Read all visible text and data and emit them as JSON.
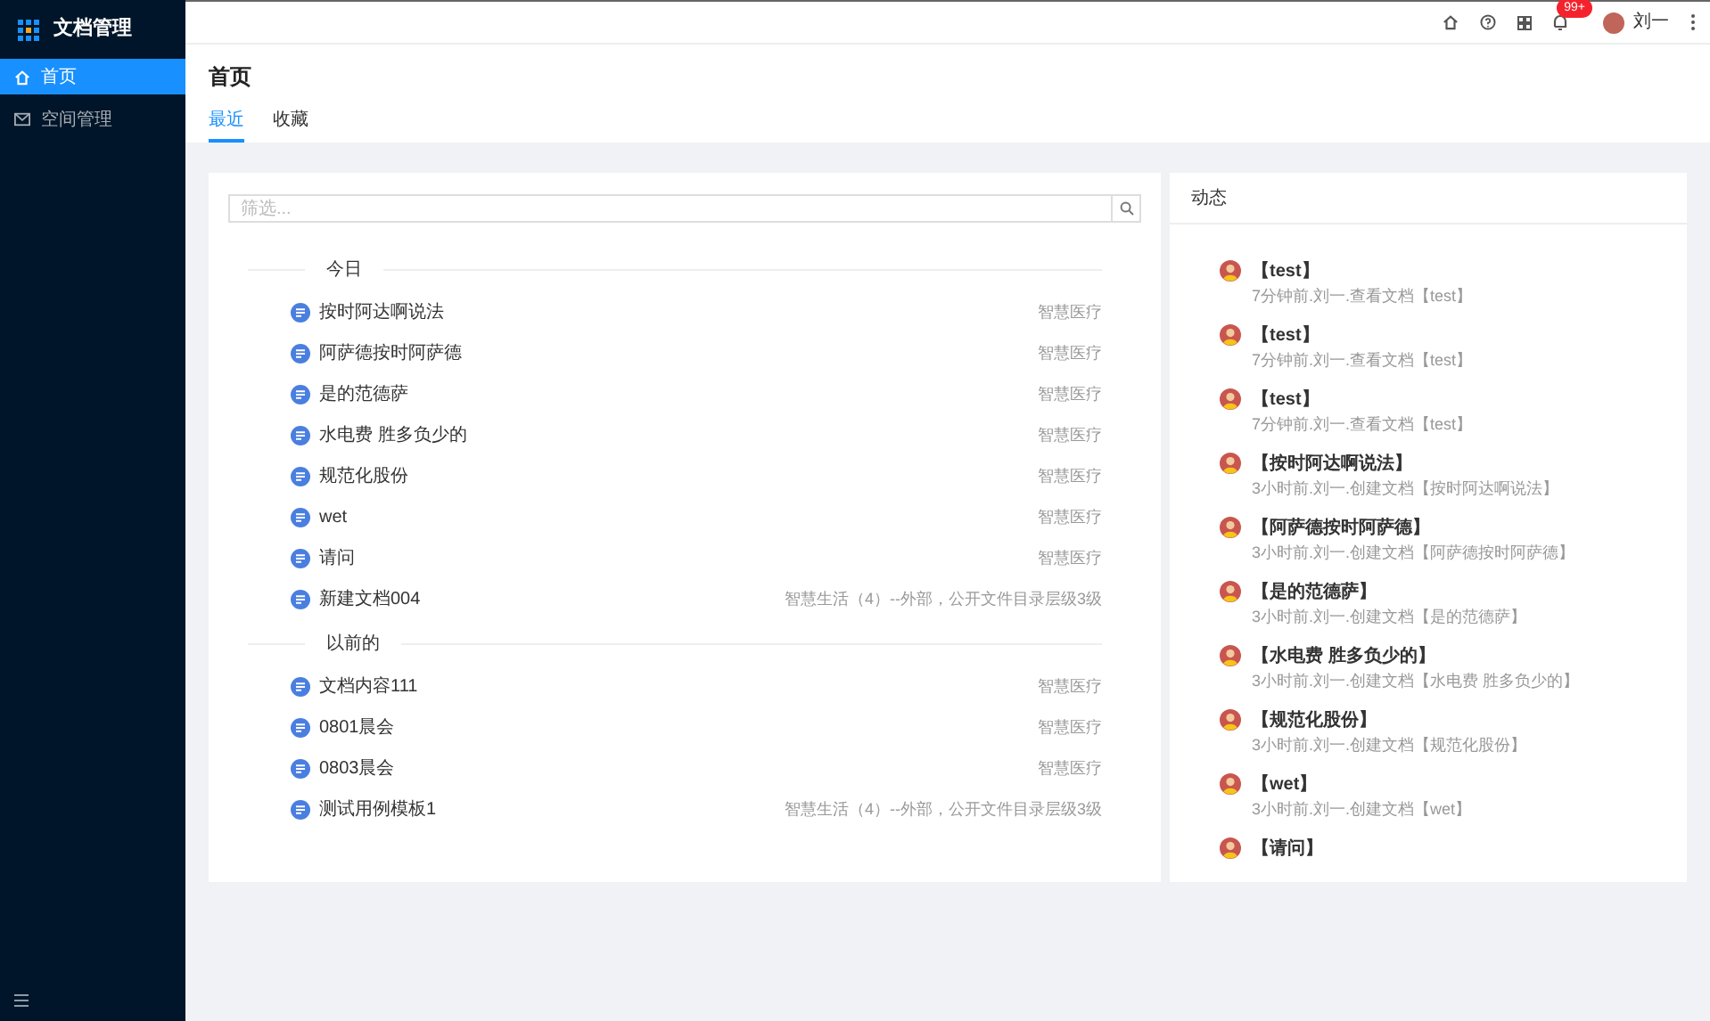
{
  "app": {
    "title": "文档管理"
  },
  "sidebar": {
    "items": [
      {
        "label": "首页",
        "kind": "home",
        "selected": true
      },
      {
        "label": "空间管理",
        "kind": "mail",
        "selected": false
      }
    ]
  },
  "header": {
    "notification_badge": "99+",
    "user_name": "刘一"
  },
  "page": {
    "title": "首页",
    "tabs": [
      {
        "label": "最近",
        "selected": true
      },
      {
        "label": "收藏",
        "selected": false
      }
    ]
  },
  "documents": {
    "search": {
      "placeholder": "筛选..."
    },
    "groups": [
      {
        "title": "今日",
        "items": [
          {
            "name": "按时阿达啊说法",
            "space": "智慧医疗"
          },
          {
            "name": "阿萨德按时阿萨德",
            "space": "智慧医疗"
          },
          {
            "name": "是的范德萨",
            "space": "智慧医疗"
          },
          {
            "name": "水电费 胜多负少的",
            "space": "智慧医疗"
          },
          {
            "name": "规范化股份",
            "space": "智慧医疗"
          },
          {
            "name": "wet",
            "space": "智慧医疗"
          },
          {
            "name": "请问",
            "space": "智慧医疗"
          },
          {
            "name": "新建文档004",
            "space": "智慧生活（4）--外部，公开文件目录层级3级"
          }
        ]
      },
      {
        "title": "以前的",
        "items": [
          {
            "name": "文档内容111",
            "space": "智慧医疗"
          },
          {
            "name": "0801晨会",
            "space": "智慧医疗"
          },
          {
            "name": "0803晨会",
            "space": "智慧医疗"
          },
          {
            "name": "测试用例模板1",
            "space": "智慧生活（4）--外部，公开文件目录层级3级"
          }
        ]
      }
    ]
  },
  "activity": {
    "title": "动态",
    "items": [
      {
        "title": "【test】",
        "detail": "7分钟前.刘一.查看文档【test】"
      },
      {
        "title": "【test】",
        "detail": "7分钟前.刘一.查看文档【test】"
      },
      {
        "title": "【test】",
        "detail": "7分钟前.刘一.查看文档【test】"
      },
      {
        "title": "【按时阿达啊说法】",
        "detail": "3小时前.刘一.创建文档【按时阿达啊说法】"
      },
      {
        "title": "【阿萨德按时阿萨德】",
        "detail": "3小时前.刘一.创建文档【阿萨德按时阿萨德】"
      },
      {
        "title": "【是的范德萨】",
        "detail": "3小时前.刘一.创建文档【是的范德萨】"
      },
      {
        "title": "【水电费 胜多负少的】",
        "detail": "3小时前.刘一.创建文档【水电费 胜多负少的】"
      },
      {
        "title": "【规范化股份】",
        "detail": "3小时前.刘一.创建文档【规范化股份】"
      },
      {
        "title": "【wet】",
        "detail": "3小时前.刘一.创建文档【wet】"
      },
      {
        "title": "【请问】"
      }
    ]
  }
}
